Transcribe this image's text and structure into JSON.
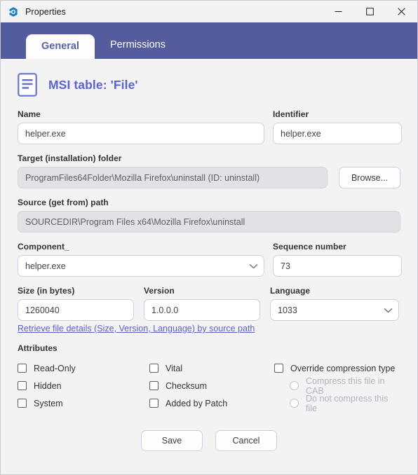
{
  "window": {
    "title": "Properties",
    "app_icon": "properties-app-icon",
    "controls": {
      "minimize": "minimize-icon",
      "maximize": "maximize-icon",
      "close": "close-icon"
    }
  },
  "tabs": [
    {
      "label": "General",
      "active": true
    },
    {
      "label": "Permissions",
      "active": false
    }
  ],
  "header": {
    "icon": "msi-table-document-icon",
    "title": "MSI table: 'File'"
  },
  "form": {
    "name": {
      "label": "Name",
      "value": "helper.exe"
    },
    "identifier": {
      "label": "Identifier",
      "value": "helper.exe"
    },
    "target_folder": {
      "label": "Target (installation) folder",
      "value": "ProgramFiles64Folder\\Mozilla Firefox\\uninstall  (ID: uninstall)",
      "browse_label": "Browse..."
    },
    "source_path": {
      "label": "Source (get from) path",
      "value": "SOURCEDIR\\Program Files x64\\Mozilla Firefox\\uninstall"
    },
    "component": {
      "label": "Component_",
      "value": "helper.exe"
    },
    "sequence_number": {
      "label": "Sequence number",
      "value": "73"
    },
    "size": {
      "label": "Size (in bytes)",
      "value": "1260040"
    },
    "version": {
      "label": "Version",
      "value": "1.0.0.0"
    },
    "language": {
      "label": "Language",
      "value": "1033"
    },
    "retrieve_link": "Retrieve file details (Size, Version, Language) by source path"
  },
  "attributes": {
    "title": "Attributes",
    "column_a": [
      {
        "label": "Read-Only",
        "checked": false
      },
      {
        "label": "Hidden",
        "checked": false
      },
      {
        "label": "System",
        "checked": false
      }
    ],
    "column_b": [
      {
        "label": "Vital",
        "checked": false
      },
      {
        "label": "Checksum",
        "checked": false
      },
      {
        "label": "Added by Patch",
        "checked": false
      }
    ],
    "override": {
      "label": "Override compression type",
      "checked": false
    },
    "compression_options": [
      {
        "label": "Compress this file in CAB",
        "selected": false,
        "disabled": true
      },
      {
        "label": "Do not compress this file",
        "selected": false,
        "disabled": true
      }
    ]
  },
  "footer": {
    "save_label": "Save",
    "cancel_label": "Cancel"
  },
  "colors": {
    "tabstrip": "#545c9e",
    "header_title": "#5a62d4",
    "link": "#5c62c9",
    "active_tab_text": "#5a62a8"
  }
}
